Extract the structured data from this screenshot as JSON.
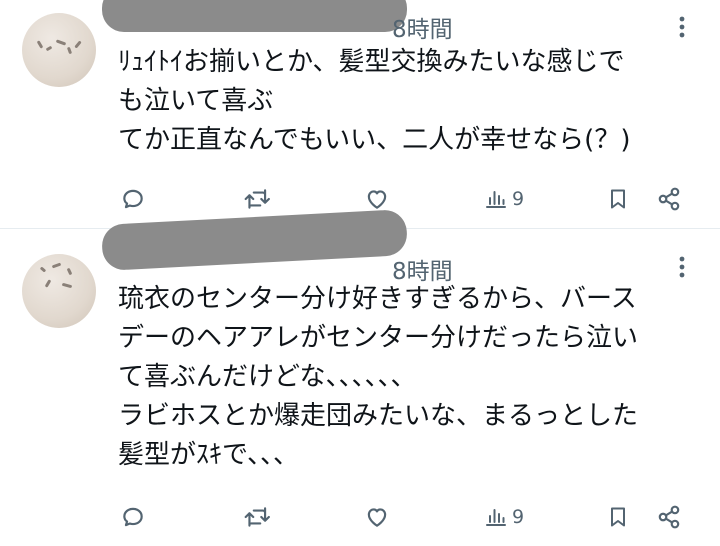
{
  "posts": [
    {
      "time": "8時間",
      "lines": [
        "ﾘｭｲﾄｲお揃いとか、髪型交換みたいな感じで",
        "も泣いて喜ぶ",
        "てか正直なんでもいい、二人が幸せなら(？)"
      ],
      "views": "9"
    },
    {
      "time": "8時間",
      "lines": [
        "琉衣のセンター分け好きすぎるから、バース",
        "デーのヘアアレがセンター分けだったら泣い",
        "て喜ぶんだけどな、、、、、、",
        "ラビホスとか爆走団みたいな、まるっとした",
        "髪型がｽｷで、、、"
      ],
      "views": "9"
    }
  ],
  "icons": {
    "reply": "reply-icon",
    "repost": "repost-icon",
    "like": "heart-icon",
    "views": "views-icon",
    "bookmark": "bookmark-icon",
    "share": "share-icon",
    "more": "more-vertical-icon"
  },
  "colors": {
    "text": "#0f1419",
    "secondary": "#536471",
    "divider": "#e6ecf0",
    "redaction": "#8b8b8b"
  }
}
